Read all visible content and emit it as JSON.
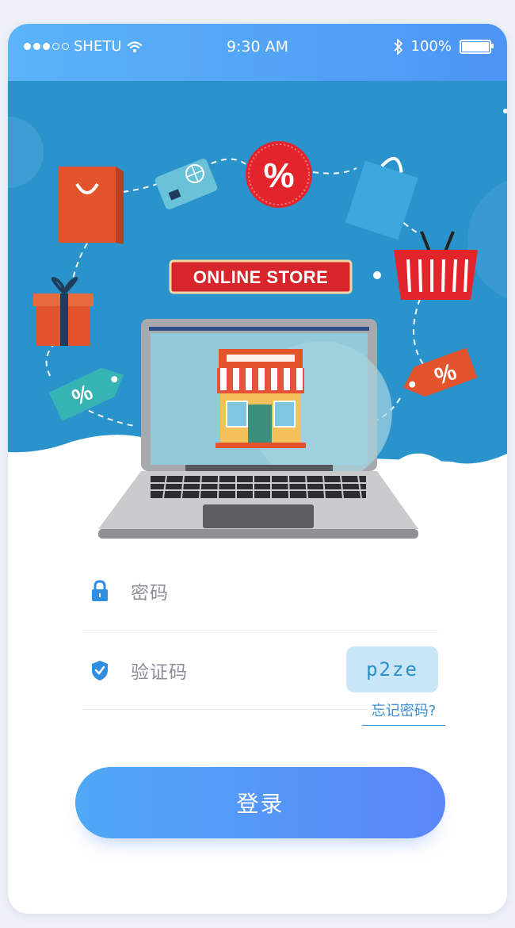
{
  "status_bar": {
    "carrier": "SHETU",
    "time": "9:30 AM",
    "battery": "100%",
    "battery_level": 1.0,
    "icons": [
      "signal-dots-icon",
      "wifi-icon",
      "bluetooth-icon",
      "battery-icon"
    ]
  },
  "hero": {
    "sign_text": "ONLINE STORE",
    "percent_symbol": "%"
  },
  "form": {
    "password_placeholder": "密码",
    "captcha_placeholder": "验证码",
    "captcha_code": "p2ze",
    "forgot_link": "忘记密码?"
  },
  "login_button": {
    "label": "登录"
  },
  "colors": {
    "primary": "#4d95f5",
    "hero_bg": "#2b93cc",
    "accent_red": "#d42a2a",
    "link": "#3d8fd6"
  }
}
